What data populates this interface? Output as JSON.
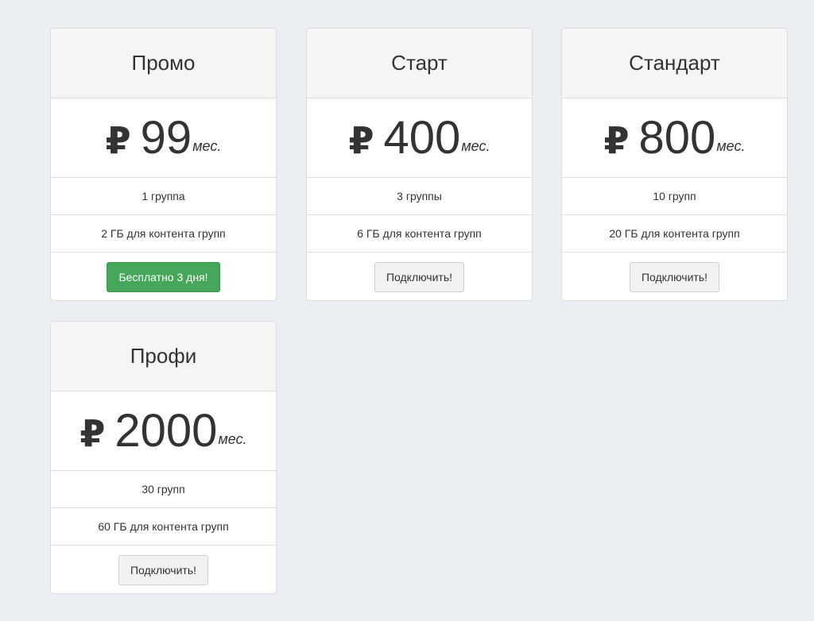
{
  "currency_symbol": "₽",
  "period_label": "мес.",
  "colors": {
    "page_background": "#ebeef3",
    "card_header_background": "#f5f5f5",
    "success_button": "#46a65a",
    "default_button": "#f2f2f2"
  },
  "plans": [
    {
      "name": "Промо",
      "price": "99",
      "features": [
        "1 группа",
        "2 ГБ для контента групп"
      ],
      "button_label": "Бесплатно 3 дня!",
      "button_style": "success"
    },
    {
      "name": "Старт",
      "price": "400",
      "features": [
        "3 группы",
        "6 ГБ для контента групп"
      ],
      "button_label": "Подключить!",
      "button_style": "default"
    },
    {
      "name": "Стандарт",
      "price": "800",
      "features": [
        "10 групп",
        "20 ГБ для контента групп"
      ],
      "button_label": "Подключить!",
      "button_style": "default"
    },
    {
      "name": "Профи",
      "price": "2000",
      "features": [
        "30 групп",
        "60 ГБ для контента групп"
      ],
      "button_label": "Подключить!",
      "button_style": "default"
    }
  ]
}
